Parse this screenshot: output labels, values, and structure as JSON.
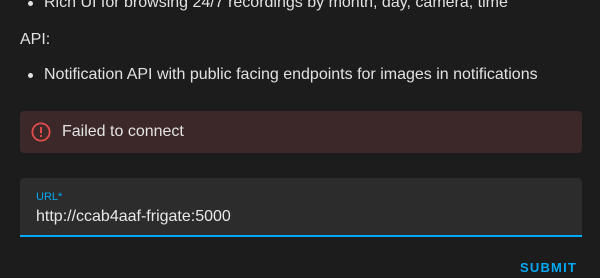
{
  "features": {
    "items": [
      "Rich UI for browsing 24/7 recordings by month, day, camera, time"
    ]
  },
  "api_section": {
    "heading": "API:",
    "items": [
      "Notification API with public facing endpoints for images in notifications"
    ]
  },
  "error": {
    "icon": "alert-circle-outline-icon",
    "message": "Failed to connect",
    "color": "#e44c4c",
    "background": "#3c2828"
  },
  "url_field": {
    "label": "URL*",
    "value": "http://ccab4aaf-frigate:5000"
  },
  "actions": {
    "submit_label": "SUBMIT"
  },
  "colors": {
    "accent": "#03a9f4",
    "background": "#1c1c1c",
    "field_background": "#2c2c2c"
  }
}
